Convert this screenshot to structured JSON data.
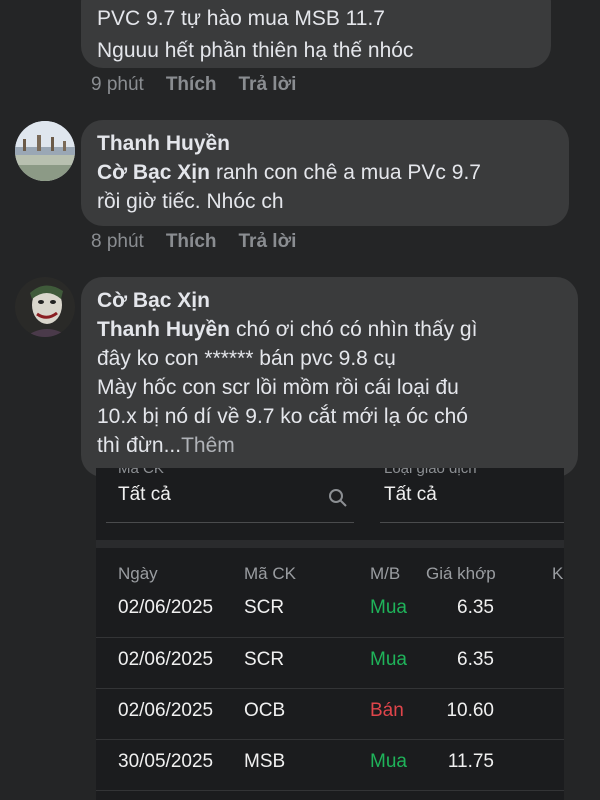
{
  "comments": [
    {
      "lines": [
        "PVC 9.7 tự hào mua MSB 11.7",
        "Nguuu hết phần thiên hạ thế nhóc"
      ],
      "time": "9 phút",
      "like": "Thích",
      "reply": "Trả lời"
    },
    {
      "author": "Thanh Huyền",
      "mention": "Cờ Bạc Xịn",
      "line1": "ranh con chê a mua PVc 9.7",
      "line2": "rồi giờ tiếc. Nhóc ch",
      "time": "8 phút",
      "like": "Thích",
      "reply": "Trả lời"
    },
    {
      "author": "Cờ Bạc Xịn",
      "mention": "Thanh Huyền",
      "line1": "chó ơi chó có nhìn thấy gì",
      "line2": "đây ko con ****** bán pvc 9.8 cụ",
      "line3": "Mày hốc con scr lồi mồm rồi cái loại đu",
      "line4": "10.x bị nó dí về 9.7 ko cắt mới lạ óc chó",
      "line5": "thì đừn...",
      "more": "Thêm"
    }
  ],
  "attachment": {
    "filters": {
      "code_label": "Mã CK",
      "code_value": "Tất cả",
      "type_label": "Loại giao dịch",
      "type_value": "Tất cả"
    },
    "headers": [
      "Ngày",
      "Mã CK",
      "M/B",
      "Giá khớp",
      "Kl"
    ],
    "rows": [
      {
        "date": "02/06/2025",
        "code": "SCR",
        "side": "Mua",
        "price": "6.35"
      },
      {
        "date": "02/06/2025",
        "code": "SCR",
        "side": "Mua",
        "price": "6.35"
      },
      {
        "date": "02/06/2025",
        "code": "OCB",
        "side": "Bán",
        "price": "10.60"
      },
      {
        "date": "30/05/2025",
        "code": "MSB",
        "side": "Mua",
        "price": "11.75"
      }
    ],
    "colors": {
      "buy": "#1fb35a",
      "sell": "#e0454b"
    }
  }
}
